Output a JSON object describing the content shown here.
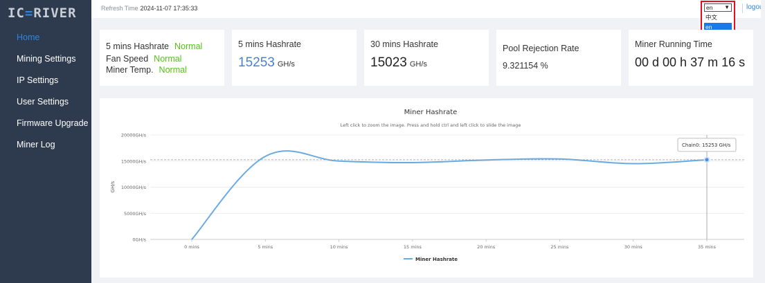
{
  "logo": {
    "left": "IC",
    "accent": "=",
    "right": "RIVER"
  },
  "sidebar": {
    "items": [
      {
        "label": "Home",
        "active": true
      },
      {
        "label": "Mining Settings"
      },
      {
        "label": "IP Settings"
      },
      {
        "label": "User Settings"
      },
      {
        "label": "Firmware Upgrade"
      },
      {
        "label": "Miner Log"
      }
    ]
  },
  "topbar": {
    "refresh_label": "Refresh Time",
    "refresh_time": "2024-11-07 17:35:33",
    "language": {
      "selected": "en",
      "options": [
        "中文",
        "en"
      ]
    },
    "logout": "logout"
  },
  "status": {
    "hashrate_label": "5 mins Hashrate",
    "hashrate_state": "Normal",
    "fan_label": "Fan Speed",
    "fan_state": "Normal",
    "temp_label": "Miner Temp.",
    "temp_state": "Normal"
  },
  "cards": {
    "h5_title": "5 mins Hashrate",
    "h5_value": "15253",
    "h5_unit": "GH/s",
    "h30_title": "30 mins Hashrate",
    "h30_value": "15023",
    "h30_unit": "GH/s",
    "reject_title": "Pool Rejection Rate",
    "reject_value": "9.321154 %",
    "runtime_title": "Miner Running Time",
    "runtime_value": "00 d 00 h 37 m 16 s"
  },
  "colors": {
    "sidebar": "#2e3a4d",
    "accent": "#2e86de",
    "normal": "#52c41a",
    "series": "#6aaae4"
  },
  "chart_data": {
    "type": "line",
    "title": "Miner Hashrate",
    "subtitle": "Left click to zoom the image. Press and hold ctrl and left click to slide the image",
    "ylabel": "GH/s",
    "ylim": [
      0,
      20000
    ],
    "yticks": [
      "0GH/s",
      "5000GH/s",
      "10000GH/s",
      "15000GH/s",
      "20000GH/s"
    ],
    "categories": [
      "0 mins",
      "5 mins",
      "10 mins",
      "15 mins",
      "20 mins",
      "25 mins",
      "30 mins",
      "35 mins"
    ],
    "x_points": [
      0,
      5,
      10,
      15,
      20,
      25,
      30,
      35
    ],
    "series": [
      {
        "name": "Miner Hashrate",
        "values": [
          0,
          15900,
          15000,
          14700,
          15200,
          15400,
          14500,
          15253
        ]
      }
    ],
    "tooltip": "Chain0: 15253 GH/s",
    "legend_position": "bottom"
  }
}
